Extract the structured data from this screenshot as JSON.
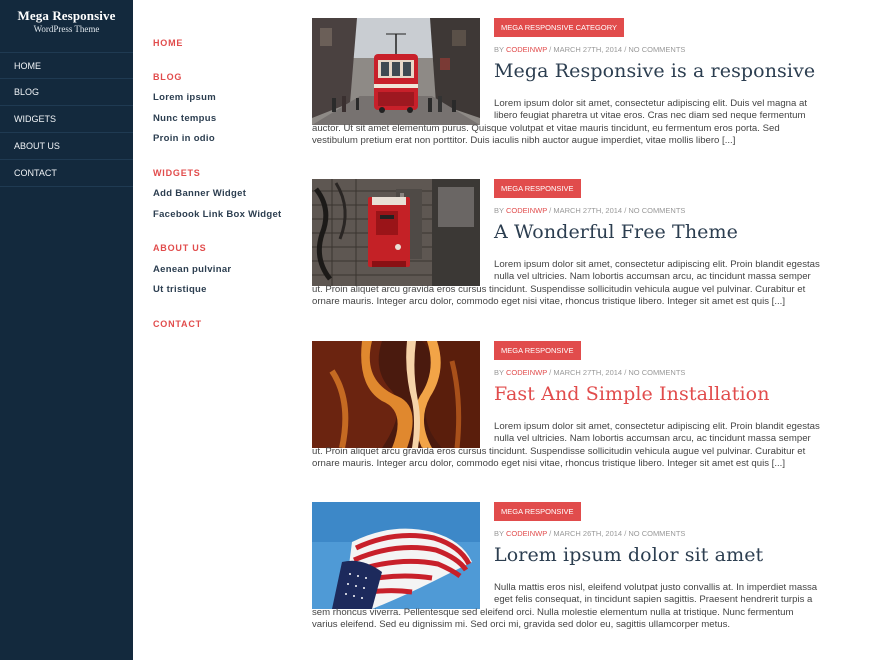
{
  "site": {
    "title": "Mega Responsive",
    "description": "WordPress Theme"
  },
  "main_nav": {
    "items": [
      "HOME",
      "BLOG",
      "WIDGETS",
      "ABOUT US",
      "CONTACT"
    ]
  },
  "sub_menu": {
    "home": "HOME",
    "blog": "BLOG",
    "blog_items": [
      "Lorem ipsum",
      "Nunc tempus",
      "Proin in odio"
    ],
    "widgets": "WIDGETS",
    "widget_items": [
      "Add Banner Widget",
      "Facebook Link Box Widget"
    ],
    "about": "ABOUT US",
    "about_items": [
      "Aenean pulvinar",
      "Ut tristique"
    ],
    "contact": "CONTACT"
  },
  "posts": [
    {
      "category": "MEGA RESPONSIVE CATEGORY",
      "by": "BY ",
      "author": "CODEINWP",
      "meta_rest": " / MARCH 27TH, 2014 / NO COMMENTS",
      "title": "Mega Responsive is a responsive",
      "excerpt": "Lorem ipsum dolor sit amet, consectetur adipiscing elit. Duis vel magna at libero feugiat pharetra ut vitae eros. Cras nec diam sed neque fermentum auctor. Ut sit amet elementum purus. Quisque volutpat et vitae mauris tincidunt, eu fermentum eros porta. Sed vestibulum pretium erat non porttitor. Duis iaculis nibh auctor augue imperdiet, vitae mollis libero [...]",
      "image": "tram-street-photo"
    },
    {
      "category": "MEGA RESPONSIVE",
      "by": "BY ",
      "author": "CODEINWP",
      "meta_rest": " / MARCH 27TH, 2014 / NO COMMENTS",
      "title": "A Wonderful Free Theme",
      "excerpt": "Lorem ipsum dolor sit amet, consectetur adipiscing elit. Proin blandit egestas nulla vel ultricies. Nam lobortis accumsan arcu, ac tincidunt massa semper ut. Proin aliquet arcu gravida eros cursus tincidunt. Suspendisse sollicitudin vehicula augue vel pulvinar. Curabitur et ornare mauris. Integer arcu dolor, commodo eget nisi vitae, rhoncus tristique libero. Integer sit amet est quis [...]",
      "image": "red-mailbox-photo"
    },
    {
      "category": "MEGA RESPONSIVE",
      "by": "BY ",
      "author": "CODEINWP",
      "meta_rest": " / MARCH 27TH, 2014 / NO COMMENTS",
      "title": "Fast And Simple Installation",
      "excerpt": "Lorem ipsum dolor sit amet, consectetur adipiscing elit. Proin blandit egestas nulla vel ultricies. Nam lobortis accumsan arcu, ac tincidunt massa semper ut. Proin aliquet arcu gravida eros cursus tincidunt. Suspendisse sollicitudin vehicula augue vel pulvinar. Curabitur et ornare mauris. Integer arcu dolor, commodo eget nisi vitae, rhoncus tristique libero. Integer sit amet est quis [...]",
      "image": "canyon-photo"
    },
    {
      "category": "MEGA RESPONSIVE",
      "by": "BY ",
      "author": "CODEINWP",
      "meta_rest": " / MARCH 26TH, 2014 / NO COMMENTS",
      "title": "Lorem ipsum dolor sit amet",
      "excerpt": "Nulla mattis eros nisl, eleifend volutpat justo convallis at. In imperdiet massa eget felis consequat, in tincidunt sapien sagittis. Praesent hendrerit turpis a sem rhoncus viverra. Pellentesque sed eleifend orci. Nulla molestie elementum nulla at tristique. Nunc fermentum varius eleifend. Sed eu dignissim mi. Sed orci mi, gravida sed dolor eu, sagittis ullamcorper metus.",
      "image": "american-flag-photo"
    }
  ],
  "colors": {
    "sidebar_bg": "#13293d",
    "accent": "#e14c4c",
    "heading": "#2c3e50"
  }
}
